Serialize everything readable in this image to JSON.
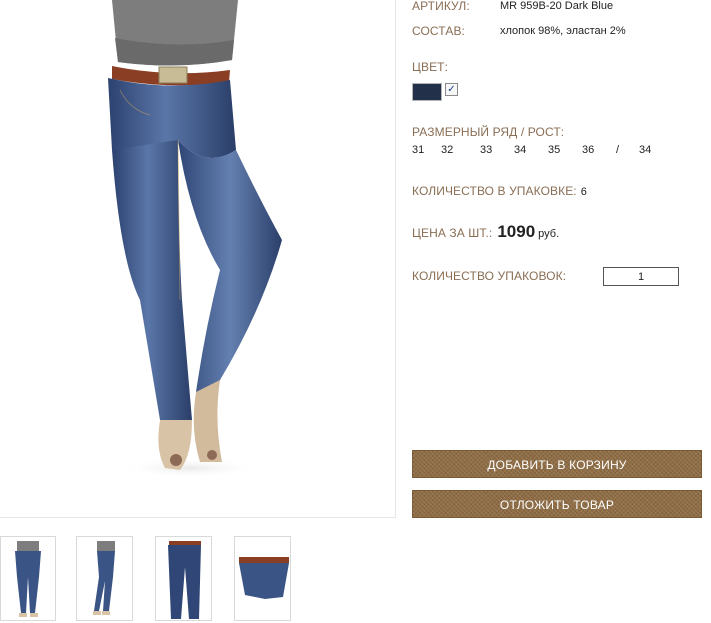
{
  "product": {
    "article_label": "АРТИКУЛ:",
    "article_value": "MR 959B-20 Dark Blue",
    "composition_label": "СОСТАВ:",
    "composition_value": "хлопок 98%, эластан 2%",
    "color_label": "ЦВЕТ:",
    "color_swatch": "#223049",
    "color_checked": "✓",
    "size_label": "РАЗМЕРНЫЙ РЯД / РОСТ:",
    "sizes": [
      "31",
      "32",
      "33",
      "34",
      "35",
      "36",
      "/",
      "34"
    ],
    "pack_label": "КОЛИЧЕСТВО В УПАКОВКЕ:",
    "pack_value": "6",
    "price_label": "ЦЕНА ЗА ШТ.:",
    "price_value": "1090",
    "price_currency": "руб.",
    "qty_label": "КОЛИЧЕСТВО УПАКОВОК:",
    "qty_value": "1"
  },
  "actions": {
    "add_to_cart": "ДОБАВИТЬ В КОРЗИНУ",
    "save_for_later": "ОТЛОЖИТЬ ТОВАР"
  },
  "colors": {
    "label": "#8a6e54",
    "button": "#8f6d45",
    "denim": "#3a5485"
  },
  "thumbnails": [
    "front-view",
    "side-view",
    "flat-front-view",
    "waist-closeup"
  ]
}
